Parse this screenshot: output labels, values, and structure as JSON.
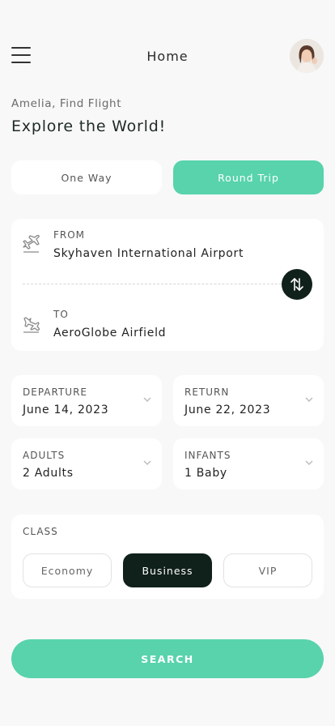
{
  "header": {
    "title": "Home",
    "menu_icon": "hamburger-menu-icon",
    "avatar_icon": "user-avatar"
  },
  "intro": {
    "greeting": "Amelia, Find Flight",
    "headline": "Explore the World!"
  },
  "trip_type": {
    "options": [
      "One Way",
      "Round Trip"
    ],
    "selected": "Round Trip"
  },
  "route": {
    "from_label": "FROM",
    "from_value": "Skyhaven International Airport",
    "to_label": "TO",
    "to_value": "AeroGlobe Airfield",
    "swap_icon": "swap-arrows-icon",
    "takeoff_icon": "plane-takeoff-icon",
    "landing_icon": "plane-landing-icon"
  },
  "dates": {
    "departure_label": "DEPARTURE",
    "departure_value": "June 14, 2023",
    "return_label": "RETURN",
    "return_value": "June 22, 2023"
  },
  "passengers": {
    "adults_label": "ADULTS",
    "adults_value": "2 Adults",
    "infants_label": "INFANTS",
    "infants_value": "1 Baby"
  },
  "travel_class": {
    "title": "CLASS",
    "options": [
      "Economy",
      "Business",
      "VIP"
    ],
    "selected": "Business"
  },
  "search": {
    "label": "SEARCH"
  },
  "colors": {
    "accent": "#58d3ac",
    "dark": "#10201a",
    "background": "#f8f8f8",
    "card": "#ffffff"
  }
}
